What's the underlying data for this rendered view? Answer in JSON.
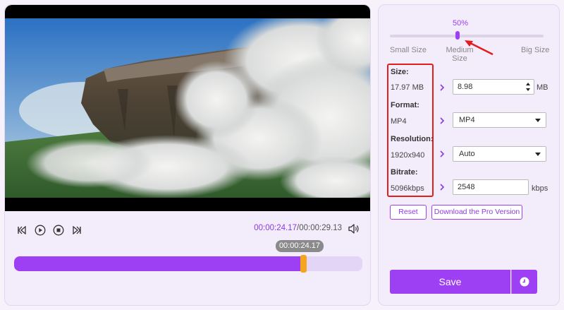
{
  "player": {
    "current_time": "00:00:24.17",
    "separator": "/",
    "total_time": "00:00:29.13",
    "tooltip_time": "00:00:24.17",
    "progress": 0.83,
    "controls": [
      "rewind-icon",
      "play-icon",
      "stop-icon",
      "fast-forward-icon",
      "volume-icon"
    ]
  },
  "compress": {
    "size_percent_label": "50%",
    "size_percent": 0.44,
    "slider_labels": {
      "small": "Small Size",
      "medium_line1": "Medium",
      "medium_line2": "Size",
      "big": "Big Size"
    },
    "size": {
      "label": "Size:",
      "original": "17.97 MB",
      "target": "8.98",
      "unit": "MB"
    },
    "format": {
      "label": "Format:",
      "original": "MP4",
      "selected": "MP4"
    },
    "resolution": {
      "label": "Resolution:",
      "original": "1920x940",
      "selected": "Auto"
    },
    "bitrate": {
      "label": "Bitrate:",
      "original": "5096kbps",
      "target": "2548",
      "unit": "kbps"
    },
    "buttons": {
      "reset": "Reset",
      "download_pro": "Download the Pro Version",
      "save": "Save"
    }
  },
  "colors": {
    "accent": "#9d3ff2",
    "handle": "#f4a51c",
    "annotation": "#e31d1d",
    "panel_bg": "#f3ecfb"
  }
}
